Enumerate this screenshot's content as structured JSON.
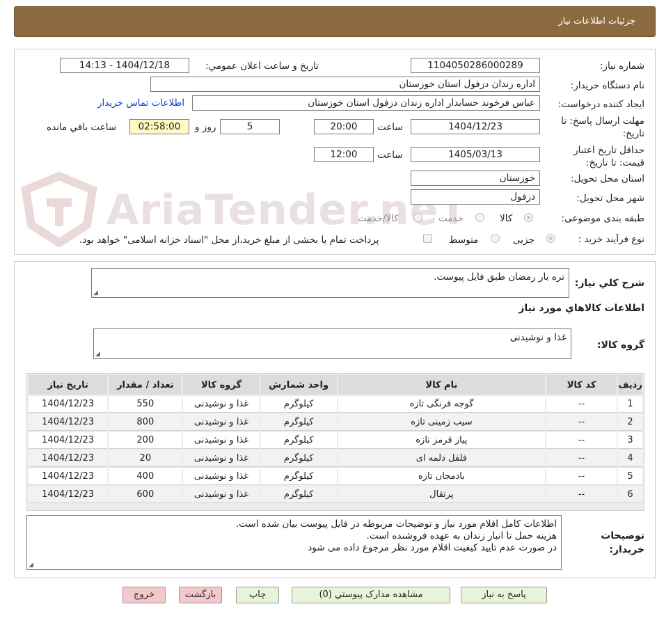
{
  "title": "جزئیات اطلاعات نیاز",
  "form": {
    "need_number_label": "شماره نیاز:",
    "need_number": "1104050286000289",
    "announce_label": "تاریخ و ساعت اعلان عمومي:",
    "announce_value": "1404/12/18 - 14:13",
    "buyer_org_label": "نام دستگاه خريدار:",
    "buyer_org": "اداره زندان دزفول استان خوزستان",
    "requester_label": "ايجاد کننده درخواست:",
    "requester": "عباس فرخوند حسابدار اداره زندان دزفول استان خوزستان",
    "contact_link": "اطلاعات تماس خريدار",
    "deadline_label": "مهلت ارسال پاسخ: تا تاریخ:",
    "deadline_date": "1404/12/23",
    "time_label": "ساعت",
    "deadline_time": "20:00",
    "days_value": "5",
    "days_label": "روز و",
    "remaining_time": "02:58:00",
    "remaining_label": "ساعت باقي مانده",
    "validity_label": "حداقل تاريخ اعتبار قيمت: تا تاريخ:",
    "validity_date": "1405/03/13",
    "validity_time": "12:00",
    "province_label": "استان محل تحويل:",
    "province": "خوزستان",
    "city_label": "شهر محل تحويل:",
    "city": "دزفول",
    "category_label": "طبقه بندی موضوعی:",
    "category_options": [
      "کالا",
      "خدمت",
      "کالا/خدمت"
    ],
    "process_label": "نوع فرآیند خرید :",
    "process_options": [
      "جزیی",
      "متوسط"
    ],
    "payment_note": "پرداخت تمام یا بخشی از مبلغ خرید،از محل \"اسناد خزانه اسلامی\" خواهد بود."
  },
  "description": {
    "label": "شرح كلي نياز:",
    "value": "تره بار رمضان طبق فایل پیوست."
  },
  "goods": {
    "section_title": "اطلاعات كالاهاي مورد نياز",
    "group_label": "گروه کالا:",
    "group_value": "غذا و نوشیدنی",
    "columns": [
      "رديف",
      "کد کالا",
      "نام کالا",
      "واحد شمارش",
      "گروه کالا",
      "تعداد / مقدار",
      "تاريخ نياز"
    ],
    "rows": [
      [
        "1",
        "--",
        "گوجه فرنگی تازه",
        "کیلوگرم",
        "غذا و نوشیدنی",
        "550",
        "1404/12/23"
      ],
      [
        "2",
        "--",
        "سیب زمینی تازه",
        "کیلوگرم",
        "غذا و نوشیدنی",
        "800",
        "1404/12/23"
      ],
      [
        "3",
        "--",
        "پیاز قرمز تازه",
        "کیلوگرم",
        "غذا و نوشیدنی",
        "200",
        "1404/12/23"
      ],
      [
        "4",
        "--",
        "فلفل دلمه ای",
        "کیلوگرم",
        "غذا و نوشیدنی",
        "20",
        "1404/12/23"
      ],
      [
        "5",
        "--",
        "بادمجان تازه",
        "کیلوگرم",
        "غذا و نوشیدنی",
        "400",
        "1404/12/23"
      ],
      [
        "6",
        "--",
        "پرتقال",
        "کیلوگرم",
        "غذا و نوشیدنی",
        "600",
        "1404/12/23"
      ]
    ]
  },
  "buyer_notes": {
    "label": "توضیحات خریدار:",
    "lines": [
      "اطلاعات کامل اقلام مورد نیاز و توضیحات مربوطه در فایل پیوست بیان شده است.",
      "هزینه حمل تا انبار زندان به عهده فروشنده است.",
      "در صورت عدم تایید کیفیت اقلام مورد نظر مرجوع داده می شود"
    ]
  },
  "buttons": {
    "reply": "پاسخ به نياز",
    "attachments": "مشاهده مدارک پيوستي (0)",
    "print": "چاپ",
    "back": "بازگشت",
    "exit": "خروج"
  },
  "watermark": "AriaTender.neT",
  "colors": {
    "title_bar": "#8b6a3f",
    "highlight_time": "#fff9c4",
    "link": "#1a3cd0",
    "button_green": "#e6f5d8",
    "button_red": "#f5c9cc"
  }
}
